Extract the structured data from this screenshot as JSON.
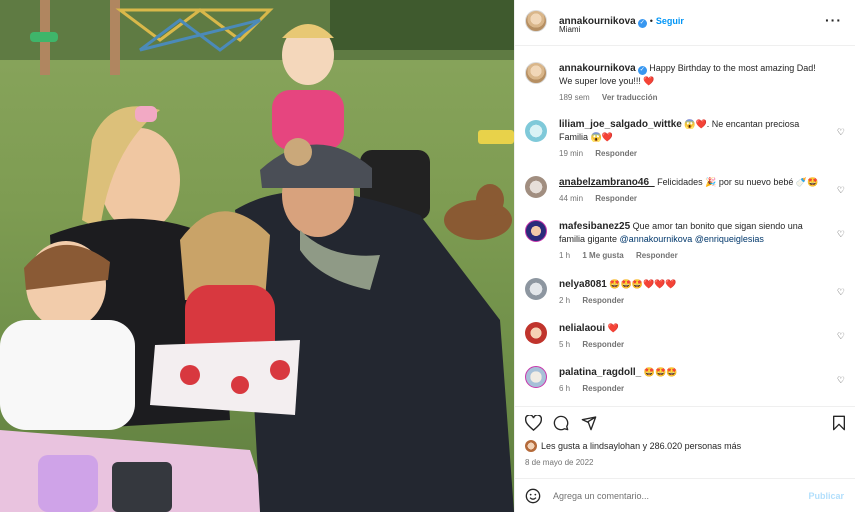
{
  "post": {
    "author": "annakournikova",
    "follow_label": "Seguir",
    "location": "Miami",
    "caption_text": "Happy Birthday to the most amazing Dad! We super love you!!! ❤️",
    "caption_age": "189 sem",
    "see_translation": "Ver traducción",
    "likes_text": "Les gusta a lindsaylohan y 286.020 personas más",
    "date": "8 de mayo de 2022",
    "add_comment_placeholder": "Agrega un comentario...",
    "publish_label": "Publicar"
  },
  "comments": [
    {
      "user": "liliam_joe_salgado_wittke",
      "text": "😱❤️. Ne encantan preciosa Familia 😱❤️",
      "age": "19 min",
      "reply": "Responder",
      "likes": ""
    },
    {
      "user": "anabelzambrano46_",
      "text": "Felicidades 🎉 por su nuevo bebé 🍼🤩",
      "age": "44 min",
      "reply": "Responder",
      "likes": ""
    },
    {
      "user": "mafesibanez25",
      "text": "Que amor tan bonito que sigan siendo una familia gigante ",
      "mentions": "@annakournikova @enriqueiglesias",
      "age": "1 h",
      "likes": "1 Me gusta",
      "reply": "Responder"
    },
    {
      "user": "nelya8081",
      "text": "🤩🤩🤩❤️❤️❤️",
      "age": "2 h",
      "reply": "Responder",
      "likes": ""
    },
    {
      "user": "nelialaoui",
      "text": "❤️",
      "age": "5 h",
      "reply": "Responder",
      "likes": ""
    },
    {
      "user": "palatina_ragdoll_",
      "text": "🤩🤩🤩",
      "age": "6 h",
      "reply": "Responder",
      "likes": ""
    }
  ],
  "icons": [
    "heart-icon",
    "comment-icon",
    "share-icon",
    "save-icon",
    "emoji-icon",
    "more-icon"
  ],
  "colors": {
    "accent": "#0095f6",
    "muted": "#737373",
    "text": "#262626",
    "heart": "#ed4956"
  }
}
